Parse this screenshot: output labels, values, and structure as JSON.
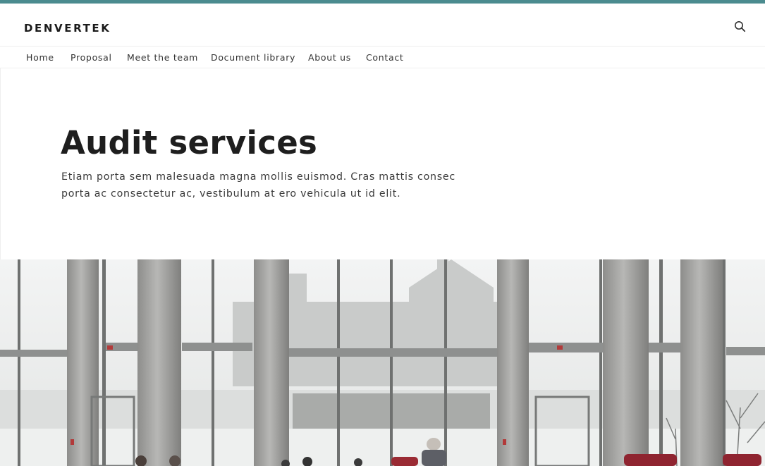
{
  "brand": {
    "name": "DENVERTEK",
    "accent_color": "#4b8b8f"
  },
  "header": {
    "search_icon": "search-icon"
  },
  "nav": {
    "items": [
      {
        "label": "Home"
      },
      {
        "label": "Proposal"
      },
      {
        "label": "Meet the team"
      },
      {
        "label": "Document library"
      },
      {
        "label": "About us"
      },
      {
        "label": "Contact"
      }
    ]
  },
  "hero": {
    "title": "Audit services",
    "description_line1": "Etiam porta sem malesuada magna mollis euismod. Cras mattis consec",
    "description_line2": "porta ac consectetur ac, vestibulum at ero vehicula ut id elit."
  },
  "photo": {
    "subject": "concrete-atrium-with-glass-windows-and-people",
    "palette": [
      "#b4b4b2",
      "#8f8f8d",
      "#e9ebea",
      "#9a2b34"
    ]
  }
}
